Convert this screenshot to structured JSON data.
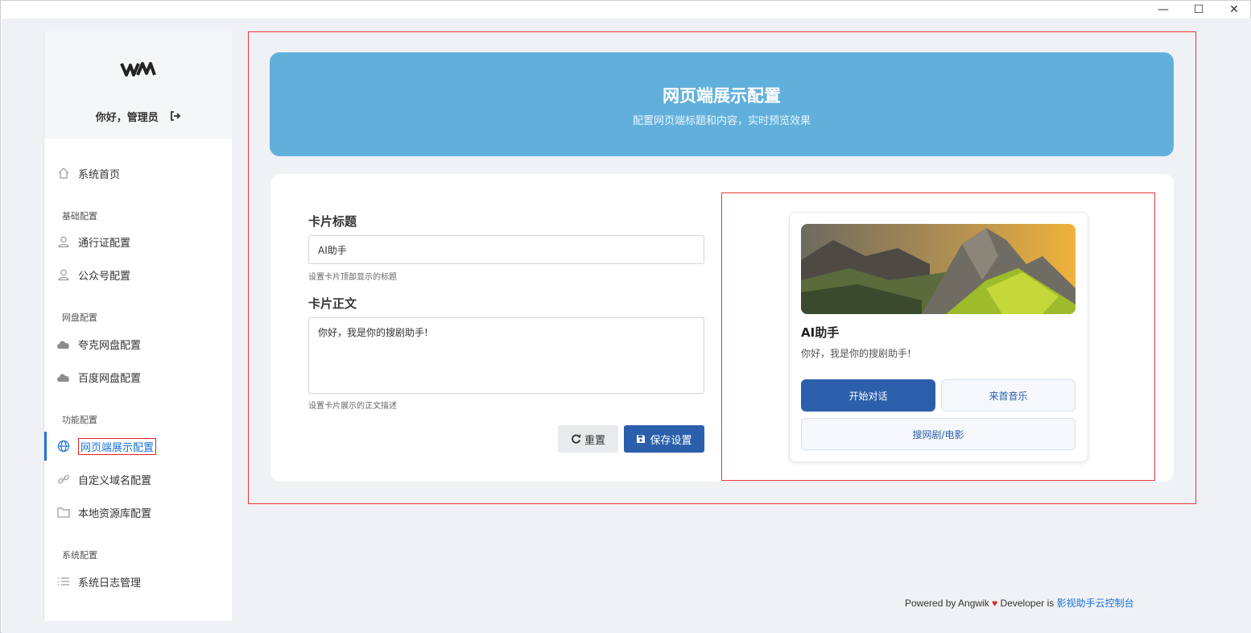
{
  "window": {
    "minimize": "—",
    "maximize": "☐",
    "close": "✕"
  },
  "sidebar": {
    "greeting": "你好，管理员",
    "items": {
      "home": "系统首页",
      "group_basic": "基础配置",
      "pass": "通行证配置",
      "wechat": "公众号配置",
      "group_disk": "网盘配置",
      "quark": "夸克网盘配置",
      "baidu": "百度网盘配置",
      "group_func": "功能配置",
      "web": "网页端展示配置",
      "domain": "自定义域名配置",
      "local": "本地资源库配置",
      "group_sys": "系统配置",
      "log": "系统日志管理"
    }
  },
  "banner": {
    "title": "网页端展示配置",
    "subtitle": "配置网页端标题和内容，实时预览效果"
  },
  "form": {
    "title_label": "卡片标题",
    "title_value": "AI助手",
    "title_help": "设置卡片顶部显示的标题",
    "body_label": "卡片正文",
    "body_value": "你好，我是你的搜剧助手!",
    "body_help": "设置卡片展示的正文描述",
    "reset_label": "重置",
    "save_label": "保存设置"
  },
  "preview": {
    "title": "AI助手",
    "body": "你好，我是你的搜剧助手!",
    "btn_chat": "开始对话",
    "btn_music": "来首音乐",
    "btn_search": "搜网剧/电影"
  },
  "footer": {
    "prefix": "Powered by Angwik",
    "middle": "Developer is",
    "link": "影视助手云控制台"
  },
  "colors": {
    "accent": "#2b5fac",
    "banner": "#61b0dc",
    "highlight": "#e53935"
  }
}
